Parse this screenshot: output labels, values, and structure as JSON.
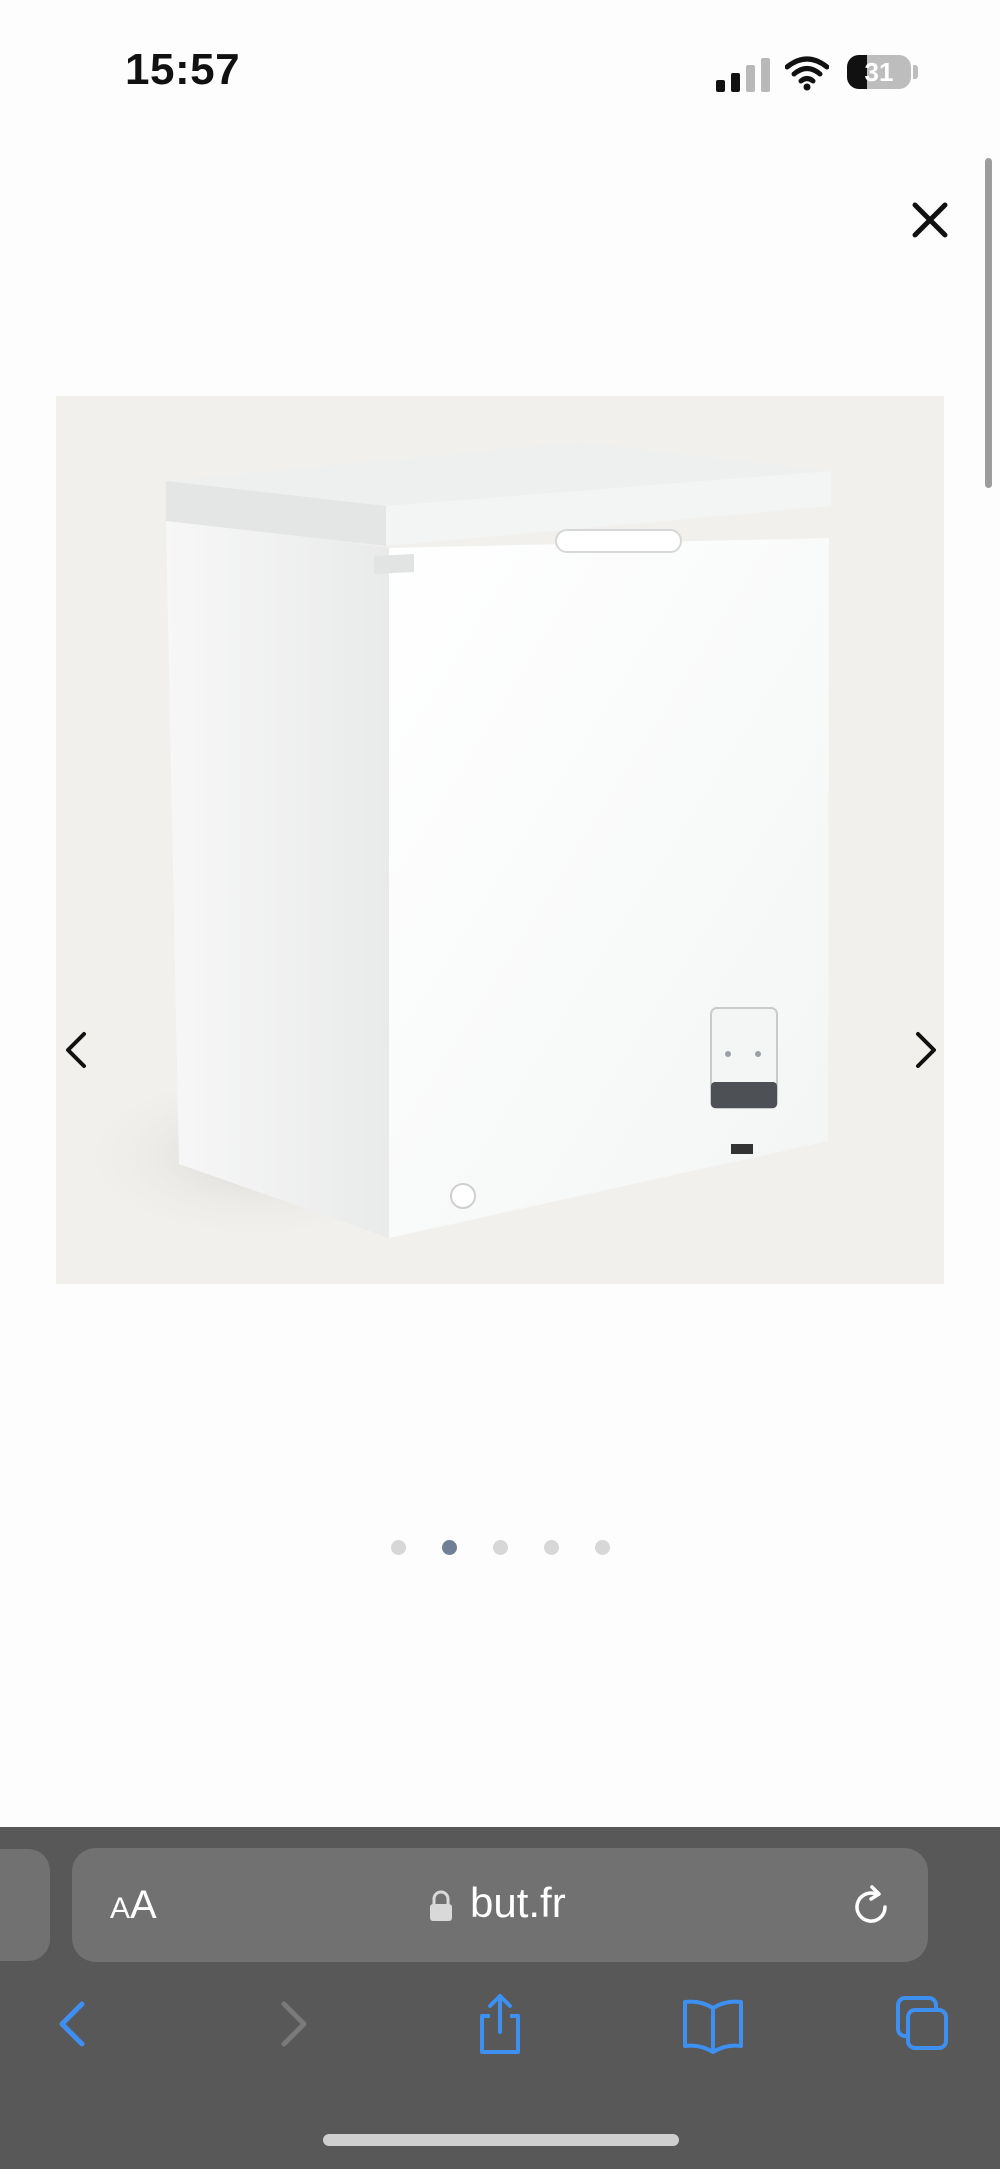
{
  "status_bar": {
    "time": "15:57",
    "battery_level": "31",
    "battery_fraction": 0.31,
    "signal_bars_active": 2,
    "signal_bars_total": 4
  },
  "gallery": {
    "close_icon": "close-icon",
    "prev_icon": "chevron-left-icon",
    "next_icon": "chevron-right-icon",
    "image_subject": "chest-freezer-product-image",
    "slide_count": 5,
    "active_slide": 2,
    "accent_color": "#6f8094"
  },
  "browser": {
    "text_size_small": "A",
    "text_size_large": "A",
    "url": "but.fr",
    "lock_icon": "lock-icon",
    "reload_icon": "reload-icon",
    "toolbar": {
      "back_icon": "back-chevron-icon",
      "forward_icon": "forward-chevron-icon",
      "share_icon": "share-icon",
      "bookmarks_icon": "bookmarks-icon",
      "tabs_icon": "tabs-icon"
    },
    "tint_color": "#3d8ff0"
  }
}
